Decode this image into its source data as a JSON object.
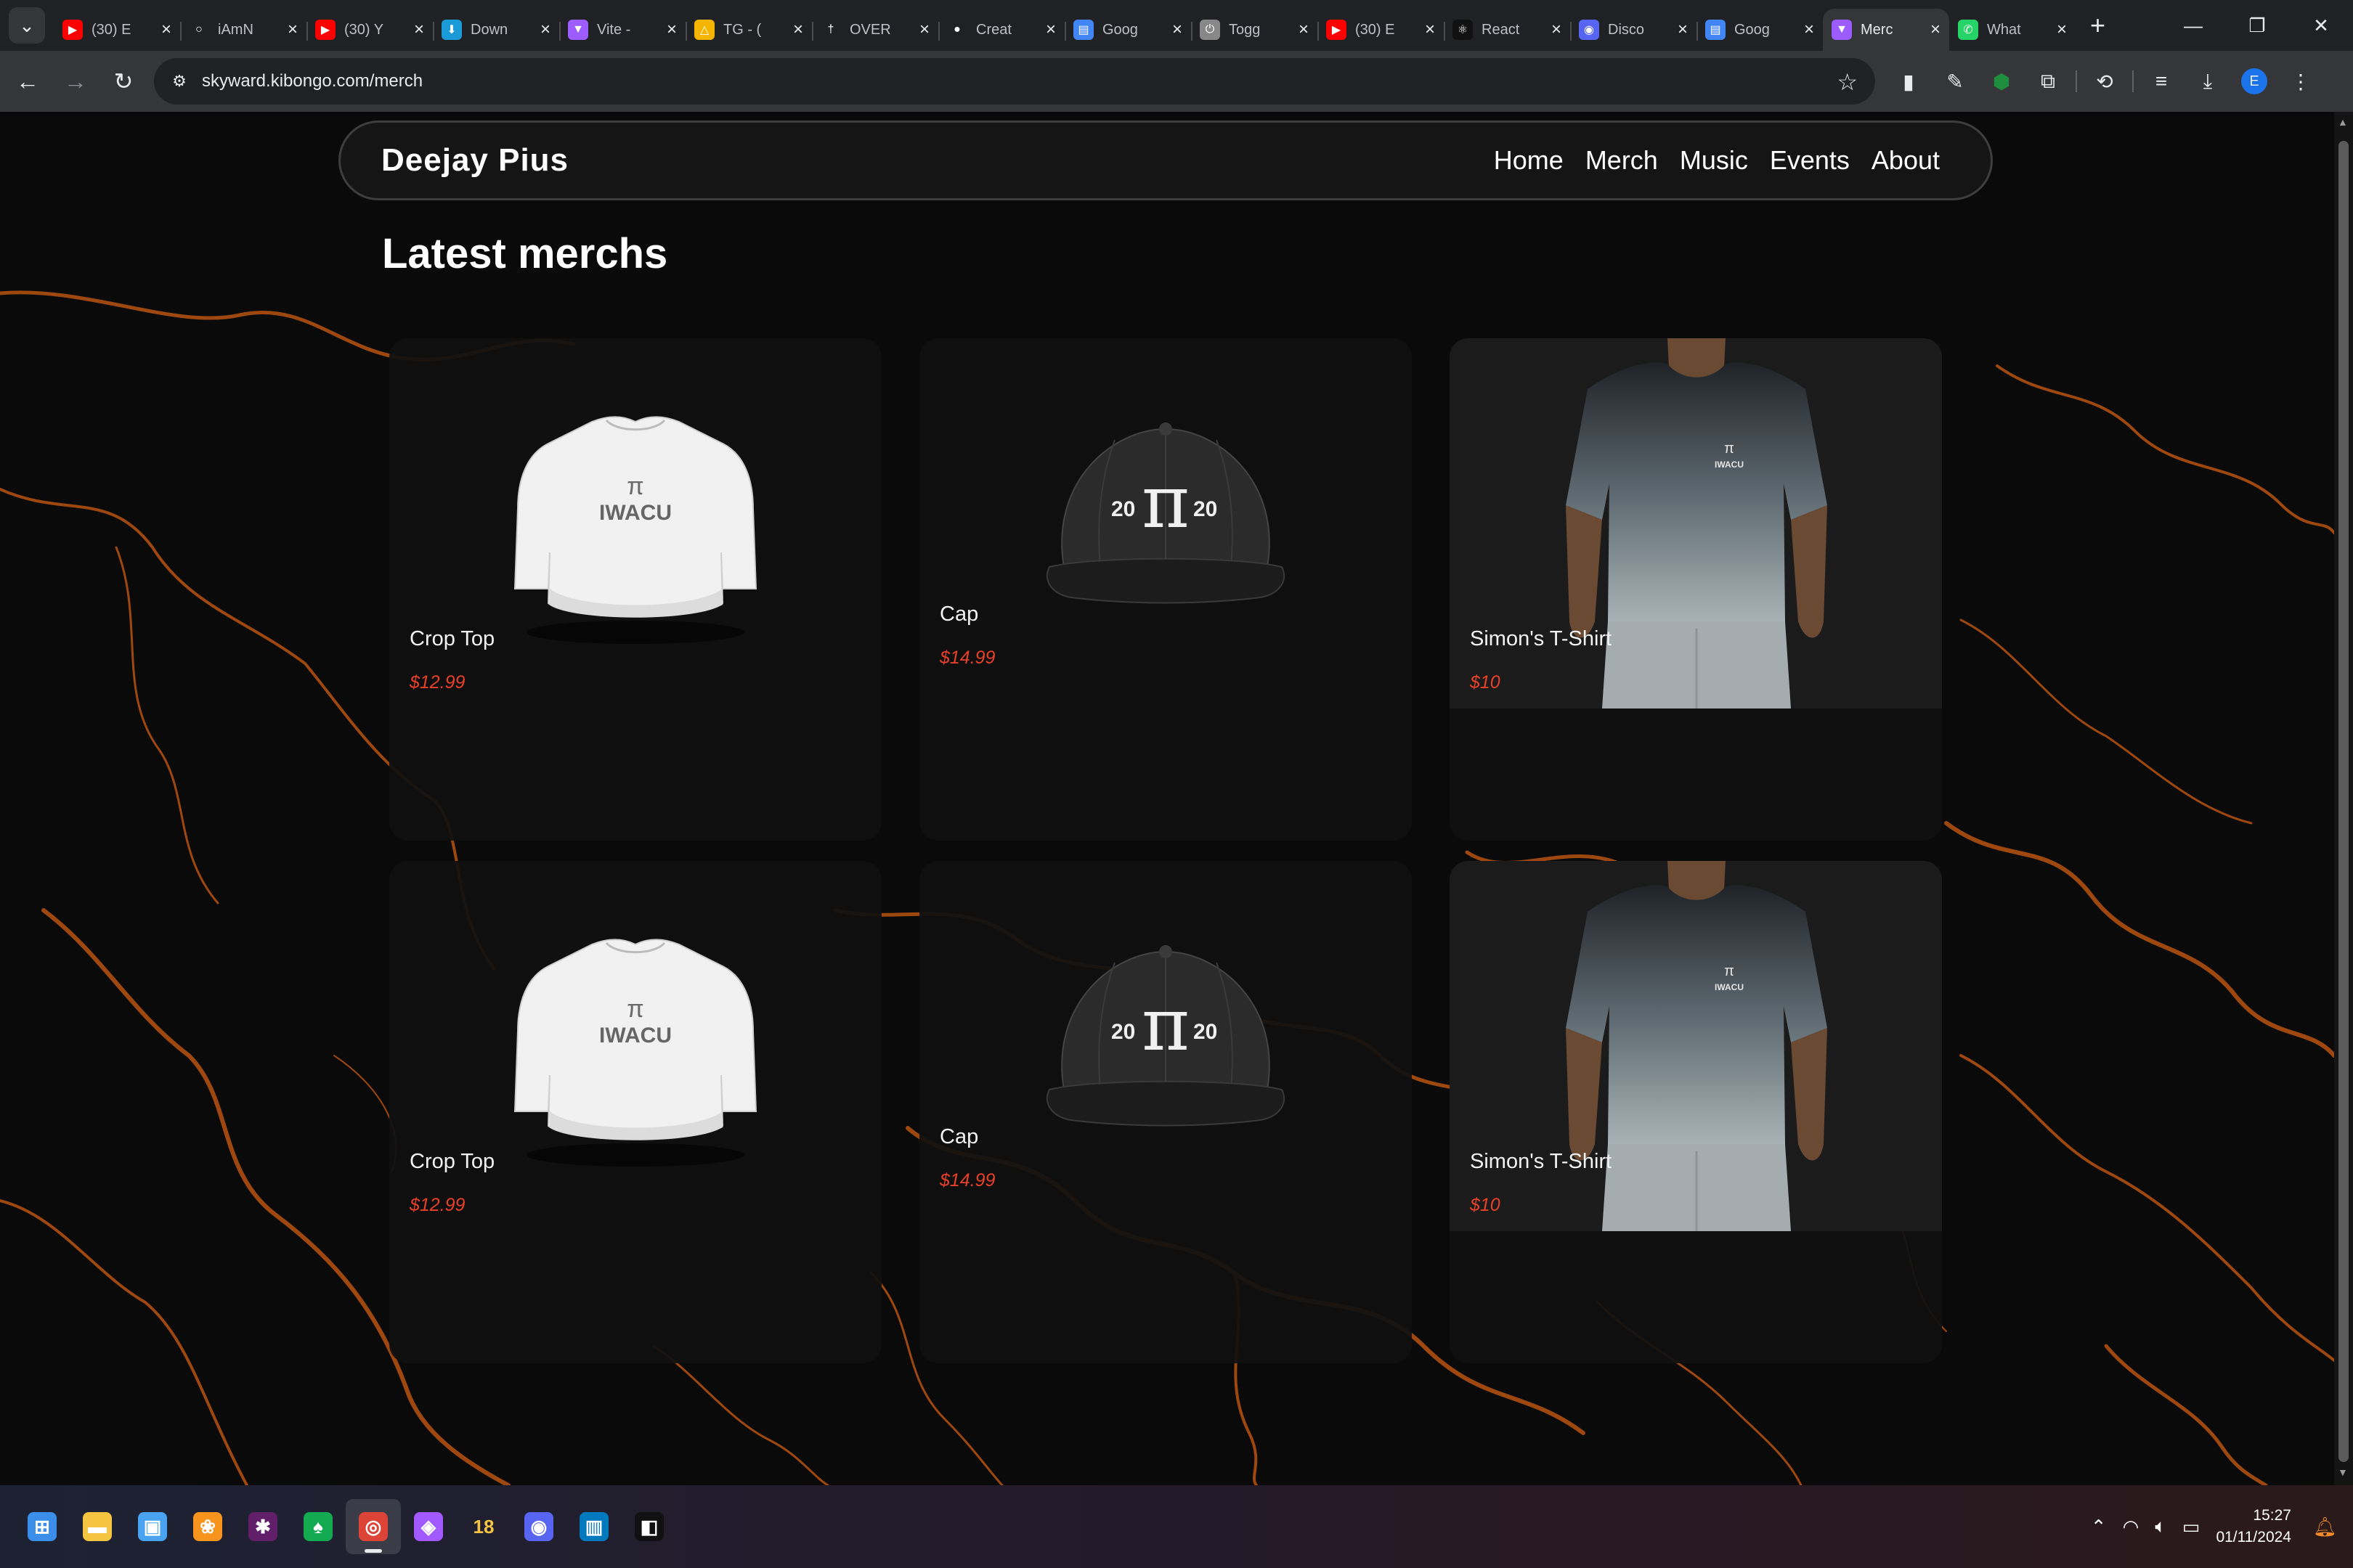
{
  "browser": {
    "tabs": [
      {
        "title": "(30) E",
        "icon": "youtube-icon",
        "color": "#ff0000"
      },
      {
        "title": "iAmN",
        "icon": "blank-page-icon",
        "color": "#202124"
      },
      {
        "title": "(30) Y",
        "icon": "youtube-icon",
        "color": "#ff0000"
      },
      {
        "title": "Down",
        "icon": "download-app-icon",
        "color": "#1a9ad6"
      },
      {
        "title": "Vite -",
        "icon": "vite-icon",
        "color": "#9c5cff"
      },
      {
        "title": "TG - (",
        "icon": "drive-icon",
        "color": "#f4b400"
      },
      {
        "title": "OVER",
        "icon": "cross-icon",
        "color": "#202124"
      },
      {
        "title": "Creat",
        "icon": "github-icon",
        "color": "#202124"
      },
      {
        "title": "Goog",
        "icon": "google-docs-icon",
        "color": "#4285f4"
      },
      {
        "title": "Togg",
        "icon": "toggl-icon",
        "color": "#888888"
      },
      {
        "title": "(30) E",
        "icon": "youtube-icon",
        "color": "#ff0000"
      },
      {
        "title": "React",
        "icon": "react-icon",
        "color": "#111111"
      },
      {
        "title": "Disco",
        "icon": "discord-icon",
        "color": "#5865f2"
      },
      {
        "title": "Goog",
        "icon": "google-docs-icon",
        "color": "#4285f4"
      },
      {
        "title": "Merc",
        "icon": "vite-icon",
        "color": "#9c5cff",
        "active": true
      },
      {
        "title": "What",
        "icon": "whatsapp-icon",
        "color": "#25d366"
      }
    ],
    "url": "skyward.kibongo.com/merch",
    "profile_initial": "E"
  },
  "site": {
    "brand": "Deejay Pius",
    "nav": [
      "Home",
      "Merch",
      "Music",
      "Events",
      "About"
    ],
    "heading": "Latest merchs",
    "products": [
      {
        "name": "Crop Top",
        "price": "$12.99",
        "kind": "crop-top"
      },
      {
        "name": "Cap",
        "price": "$14.99",
        "kind": "cap"
      },
      {
        "name": "Simon's T-Shirt",
        "price": "$10",
        "kind": "tshirt-model"
      },
      {
        "name": "Crop Top",
        "price": "$12.99",
        "kind": "crop-top"
      },
      {
        "name": "Cap",
        "price": "$14.99",
        "kind": "cap"
      },
      {
        "name": "Simon's T-Shirt",
        "price": "$10",
        "kind": "tshirt-model"
      }
    ],
    "print_text": {
      "crop_top": "IWACU",
      "cap_left": "20",
      "cap_right": "20",
      "pi": "π"
    },
    "colors": {
      "accent_price": "#e8412a",
      "crack": "#c25a12",
      "card": "#101010"
    }
  },
  "taskbar": {
    "apps": [
      {
        "name": "start",
        "icon": "windows-icon"
      },
      {
        "name": "file-explorer",
        "icon": "folder-icon"
      },
      {
        "name": "store",
        "icon": "store-icon"
      },
      {
        "name": "fl-studio",
        "icon": "fruit-icon"
      },
      {
        "name": "slack",
        "icon": "slack-icon"
      },
      {
        "name": "mongodb-compass",
        "icon": "leaf-icon"
      },
      {
        "name": "chrome",
        "icon": "chrome-icon",
        "active": true
      },
      {
        "name": "figma",
        "icon": "figma-icon"
      },
      {
        "name": "app-18",
        "icon": "number-18-icon",
        "label": "18"
      },
      {
        "name": "discord",
        "icon": "discord-icon"
      },
      {
        "name": "trello",
        "icon": "trello-icon"
      },
      {
        "name": "capcut",
        "icon": "capcut-icon"
      }
    ],
    "time": "15:27",
    "date": "01/11/2024"
  }
}
